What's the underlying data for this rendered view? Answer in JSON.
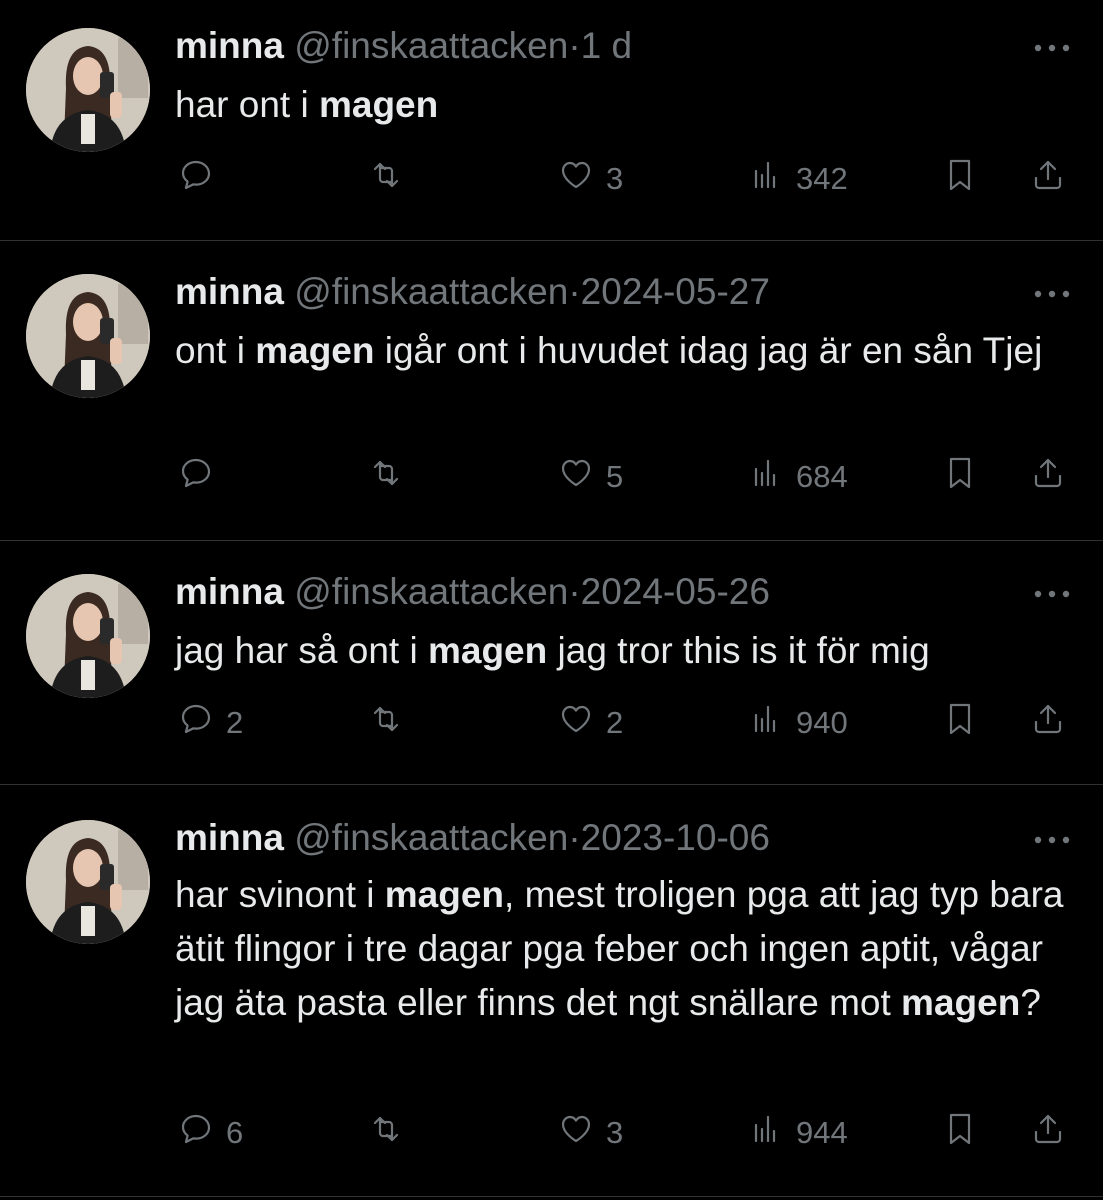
{
  "tweets": [
    {
      "name": "minna",
      "handle": "@finskaattacken",
      "dot": "·",
      "time": "1 d",
      "text_parts": [
        {
          "t": "har ont i "
        },
        {
          "t": "magen",
          "b": true
        }
      ],
      "replies": "",
      "retweets": "",
      "likes": "3",
      "views": "342"
    },
    {
      "name": "minna",
      "handle": "@finskaattacken",
      "dot": "·",
      "time": "2024-05-27",
      "text_parts": [
        {
          "t": "ont i "
        },
        {
          "t": "magen",
          "b": true
        },
        {
          "t": " igår ont i huvudet idag jag är en sån Tjej"
        }
      ],
      "replies": "",
      "retweets": "",
      "likes": "5",
      "views": "684"
    },
    {
      "name": "minna",
      "handle": "@finskaattacken",
      "dot": "·",
      "time": "2024-05-26",
      "text_parts": [
        {
          "t": "jag har så ont i "
        },
        {
          "t": "magen",
          "b": true
        },
        {
          "t": " jag tror this is it för mig"
        }
      ],
      "replies": "2",
      "retweets": "",
      "likes": "2",
      "views": "940"
    },
    {
      "name": "minna",
      "handle": "@finskaattacken",
      "dot": "·",
      "time": "2023-10-06",
      "text_parts": [
        {
          "t": "har svinont i "
        },
        {
          "t": "magen",
          "b": true
        },
        {
          "t": ", mest troligen pga att jag typ bara ätit flingor i tre dagar pga feber och ingen aptit, vågar jag äta pasta eller finns det ngt snällare mot "
        },
        {
          "t": "magen",
          "b": true
        },
        {
          "t": "?"
        }
      ],
      "replies": "6",
      "retweets": "",
      "likes": "3",
      "views": "944"
    }
  ],
  "icons": {
    "more": "more-icon",
    "reply": "reply-icon",
    "retweet": "retweet-icon",
    "like": "heart-icon",
    "views": "views-icon",
    "bookmark": "bookmark-icon",
    "share": "share-icon"
  },
  "colors": {
    "background": "#000000",
    "text": "#e7e9ea",
    "muted": "#71767b",
    "divider": "#2f3336"
  }
}
